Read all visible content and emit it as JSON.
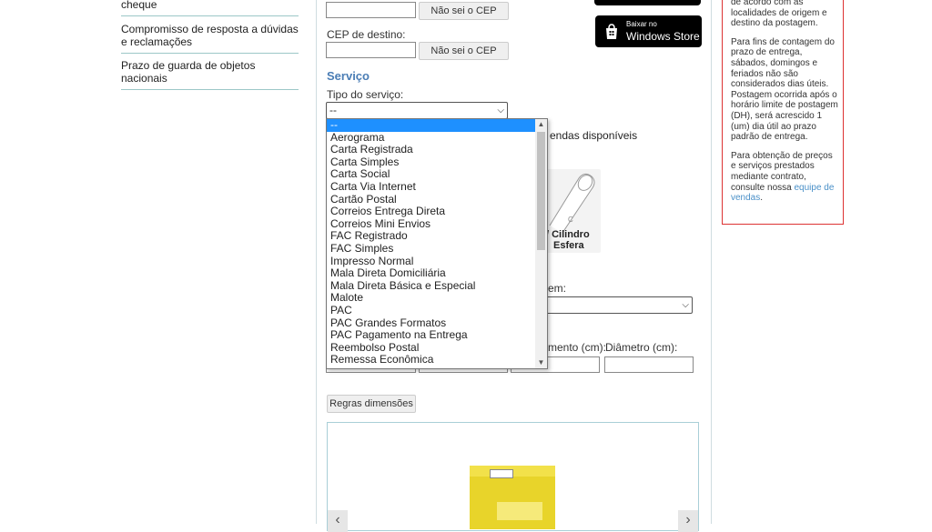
{
  "sidebar": {
    "items": [
      {
        "label": "cheque"
      },
      {
        "label": "Compromisso de resposta a dúvidas e reclamações"
      },
      {
        "label": "Prazo de guarda de objetos nacionais"
      }
    ]
  },
  "form": {
    "nao_sei_cep": "Não sei o CEP",
    "cep_destino_label": "CEP de destino:",
    "servico_title": "Serviço",
    "tipo_servico_label": "Tipo do serviço:",
    "tipo_servico_value": "--",
    "embalagens_text": "endas disponíveis",
    "cilindro_label": "/ Cilindro",
    "esfera_label": "Esfera",
    "origem_label": "em:",
    "comprimento_label": "mento (cm):",
    "diametro_label": "Diâmetro (cm):",
    "regras_button": "Regras dimensões"
  },
  "dropdown": {
    "options": [
      "--",
      "Aerograma",
      "Carta Registrada",
      "Carta Simples",
      "Carta Social",
      "Carta Via Internet",
      "Cartão Postal",
      "Correios Entrega Direta",
      "Correios Mini Envios",
      "FAC Registrado",
      "FAC Simples",
      "Impresso Normal",
      "Mala Direta Domiciliária",
      "Mala Direta Básica e Especial",
      "Malote",
      "PAC",
      "PAC Grandes Formatos",
      "PAC Pagamento na Entrega",
      "Reembolso Postal",
      "Remessa Econômica"
    ],
    "selected_index": 0
  },
  "store_badge": {
    "small": "Baixar no",
    "large": "Windows Store"
  },
  "info": {
    "p1": "de acordo com as localidades de origem e destino da postagem.",
    "p2": "Para fins de contagem do prazo de entrega, sábados, domingos e feriados não são considerados dias úteis. Postagem ocorrida após o horário limite de postagem (DH), será acrescido 1 (um) dia útil ao prazo padrão de entrega.",
    "p3_prefix": "Para obtenção de preços e serviços prestados mediante contrato, consulte nossa ",
    "p3_link": "equipe de vendas",
    "p3_suffix": "."
  },
  "colors": {
    "accent": "#4a7db5",
    "selection": "#1e90ff",
    "info_border": "#dd3333"
  }
}
